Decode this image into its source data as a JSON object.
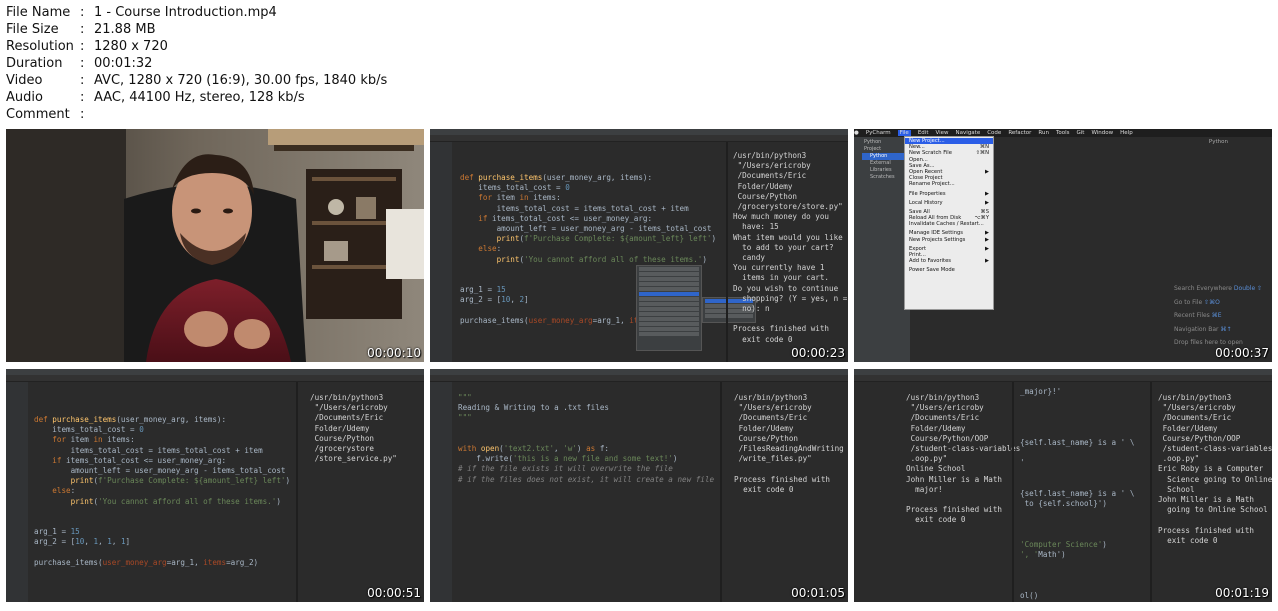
{
  "meta": {
    "rows": [
      {
        "key": "File Name",
        "value": "1 - Course Introduction.mp4"
      },
      {
        "key": "File Size",
        "value": "21.88 MB"
      },
      {
        "key": "Resolution",
        "value": "1280 x 720"
      },
      {
        "key": "Duration",
        "value": "00:01:32"
      },
      {
        "key": "Video",
        "value": "AVC, 1280 x 720 (16:9), 30.00 fps, 1840 kb/s"
      },
      {
        "key": "Audio",
        "value": "AAC, 44100 Hz, stereo, 128 kb/s"
      },
      {
        "key": "Comment",
        "value": ""
      }
    ],
    "separator": ":"
  },
  "thumbnails": [
    {
      "timestamp": "00:00:10"
    },
    {
      "timestamp": "00:00:23"
    },
    {
      "timestamp": "00:00:37"
    },
    {
      "timestamp": "00:00:51"
    },
    {
      "timestamp": "00:01:05"
    },
    {
      "timestamp": "00:01:19"
    }
  ],
  "t2": {
    "code": [
      "def purchase_items(user_money_arg, items):",
      "    items_total_cost = 0",
      "    for item in items:",
      "        items_total_cost = items_total_cost + item",
      "    if items_total_cost <= user_money_arg:",
      "        amount_left = user_money_arg - items_total_cost",
      "        print(f'Purchase Complete: ${amount_left} left')",
      "    else:",
      "        print('You cannot afford all of these items.')",
      "",
      "",
      "arg_1 = 15",
      "arg_2 = [10, 2]",
      "",
      "purchase_items(user_money_arg=arg_1, items=arg_2)"
    ],
    "line_num": "20",
    "terminal": [
      "/usr/bin/python3",
      " \"/Users/ericroby",
      " /Documents/Eric",
      " Folder/Udemy",
      " Course/Python",
      " /grocerystore/store.py\"",
      "How much money do you",
      "  have: 15",
      "What item would you like",
      "  to add to your cart?",
      "  candy",
      "You currently have 1",
      "  items in your cart.",
      "Do you wish to continue",
      "  shopping? (Y = yes, n =",
      "  no): n",
      "",
      "Process finished with",
      "  exit code 0"
    ]
  },
  "t3": {
    "menubar": [
      "PyCharm",
      "File",
      "Edit",
      "View",
      "Navigate",
      "Code",
      "Refactor",
      "Run",
      "Tools",
      "Git",
      "Window",
      "Help"
    ],
    "title": "Python",
    "tree": [
      "Python",
      "Project",
      "Python",
      "External Libraries",
      "Scratches"
    ],
    "menu": [
      {
        "label": "New Project...",
        "short": "",
        "active": true
      },
      {
        "label": "New...",
        "short": "⌘N"
      },
      {
        "label": "New Scratch File",
        "short": "⇧⌘N"
      },
      {
        "label": "Open...",
        "short": ""
      },
      {
        "label": "Save As...",
        "short": ""
      },
      {
        "label": "Open Recent",
        "short": "▶"
      },
      {
        "label": "Close Project",
        "short": ""
      },
      {
        "label": "Rename Project...",
        "short": ""
      },
      {
        "label": "",
        "short": ""
      },
      {
        "label": "File Properties",
        "short": "▶"
      },
      {
        "label": "",
        "short": ""
      },
      {
        "label": "Local History",
        "short": "▶"
      },
      {
        "label": "",
        "short": ""
      },
      {
        "label": "Save All",
        "short": "⌘S"
      },
      {
        "label": "Reload All from Disk",
        "short": "⌥⌘Y"
      },
      {
        "label": "Invalidate Caches / Restart...",
        "short": ""
      },
      {
        "label": "",
        "short": ""
      },
      {
        "label": "Manage IDE Settings",
        "short": "▶"
      },
      {
        "label": "New Projects Settings",
        "short": "▶"
      },
      {
        "label": "",
        "short": ""
      },
      {
        "label": "Export",
        "short": "▶"
      },
      {
        "label": "Print...",
        "short": ""
      },
      {
        "label": "Add to Favorites",
        "short": "▶"
      },
      {
        "label": "",
        "short": ""
      },
      {
        "label": "Power Save Mode",
        "short": ""
      }
    ],
    "hints": [
      {
        "label": "Search Everywhere",
        "key": "Double ⇧"
      },
      {
        "label": "Go to File",
        "key": "⇧⌘O"
      },
      {
        "label": "Recent Files",
        "key": "⌘E"
      },
      {
        "label": "Navigation Bar",
        "key": "⌘↑"
      },
      {
        "label": "Drop files here to open",
        "key": ""
      }
    ]
  },
  "t4": {
    "code": [
      "def purchase_items(user_money_arg, items):",
      "    items_total_cost = 0",
      "    for item in items:",
      "        items_total_cost = items_total_cost + item",
      "    if items_total_cost <= user_money_arg:",
      "        amount_left = user_money_arg - items_total_cost",
      "        print(f'Purchase Complete: ${amount_left} left')",
      "    else:",
      "        print('You cannot afford all of these items.')",
      "",
      "",
      "arg_1 = 15",
      "arg_2 = [10, 1, 1, 1]",
      "",
      "purchase_items(user_money_arg=arg_1, items=arg_2)"
    ],
    "line_num": "20",
    "terminal": [
      "/usr/bin/python3",
      " \"/Users/ericroby",
      " /Documents/Eric",
      " Folder/Udemy",
      " Course/Python",
      " /grocerystore",
      " /store_service.py\""
    ]
  },
  "t5": {
    "code": [
      "\"\"\"",
      "Reading & Writing to a .txt files",
      "\"\"\"",
      "",
      "",
      "with open('text2.txt', 'w') as f:",
      "    f.write('this is a new file and some text!')",
      "# if the file exists it will overwrite the file",
      "# if the files does not exist, it will create a new file"
    ],
    "line_num": "9",
    "terminal": [
      "/usr/bin/python3",
      " \"/Users/ericroby",
      " /Documents/Eric",
      " Folder/Udemy",
      " Course/Python",
      " /FilesReadingAndWriting",
      " /write_files.py\"",
      "",
      "Process finished with",
      "  exit code 0"
    ]
  },
  "t6": {
    "terminal_a": [
      "/usr/bin/python3",
      " \"/Users/ericroby",
      " /Documents/Eric",
      " Folder/Udemy",
      " Course/Python/OOP",
      " /student-class-variables",
      " .oop.py\"",
      "Online School",
      "John Miller is a Math",
      "  major!",
      "",
      "Process finished with",
      "  exit code 0"
    ],
    "code_frag": [
      "_major}!'",
      "",
      "",
      "",
      "",
      "{self.last_name} is a ' \\",
      "",
      "'",
      "",
      "",
      "{self.last_name} is a ' \\",
      " to {self.school}')",
      "",
      "",
      "",
      "'Computer Science')",
      "', 'Math')",
      "",
      "",
      "",
      "ol()",
      "ol())"
    ],
    "terminal_b": [
      "/usr/bin/python3",
      " \"/Users/ericroby",
      " /Documents/Eric",
      " Folder/Udemy",
      " Course/Python/OOP",
      " /student-class-variables",
      " .oop.py\"",
      "Eric Roby is a Computer",
      "  Science going to Online",
      "  School",
      "John Miller is a Math",
      "  going to Online School",
      "",
      "Process finished with",
      "  exit code 0"
    ]
  }
}
